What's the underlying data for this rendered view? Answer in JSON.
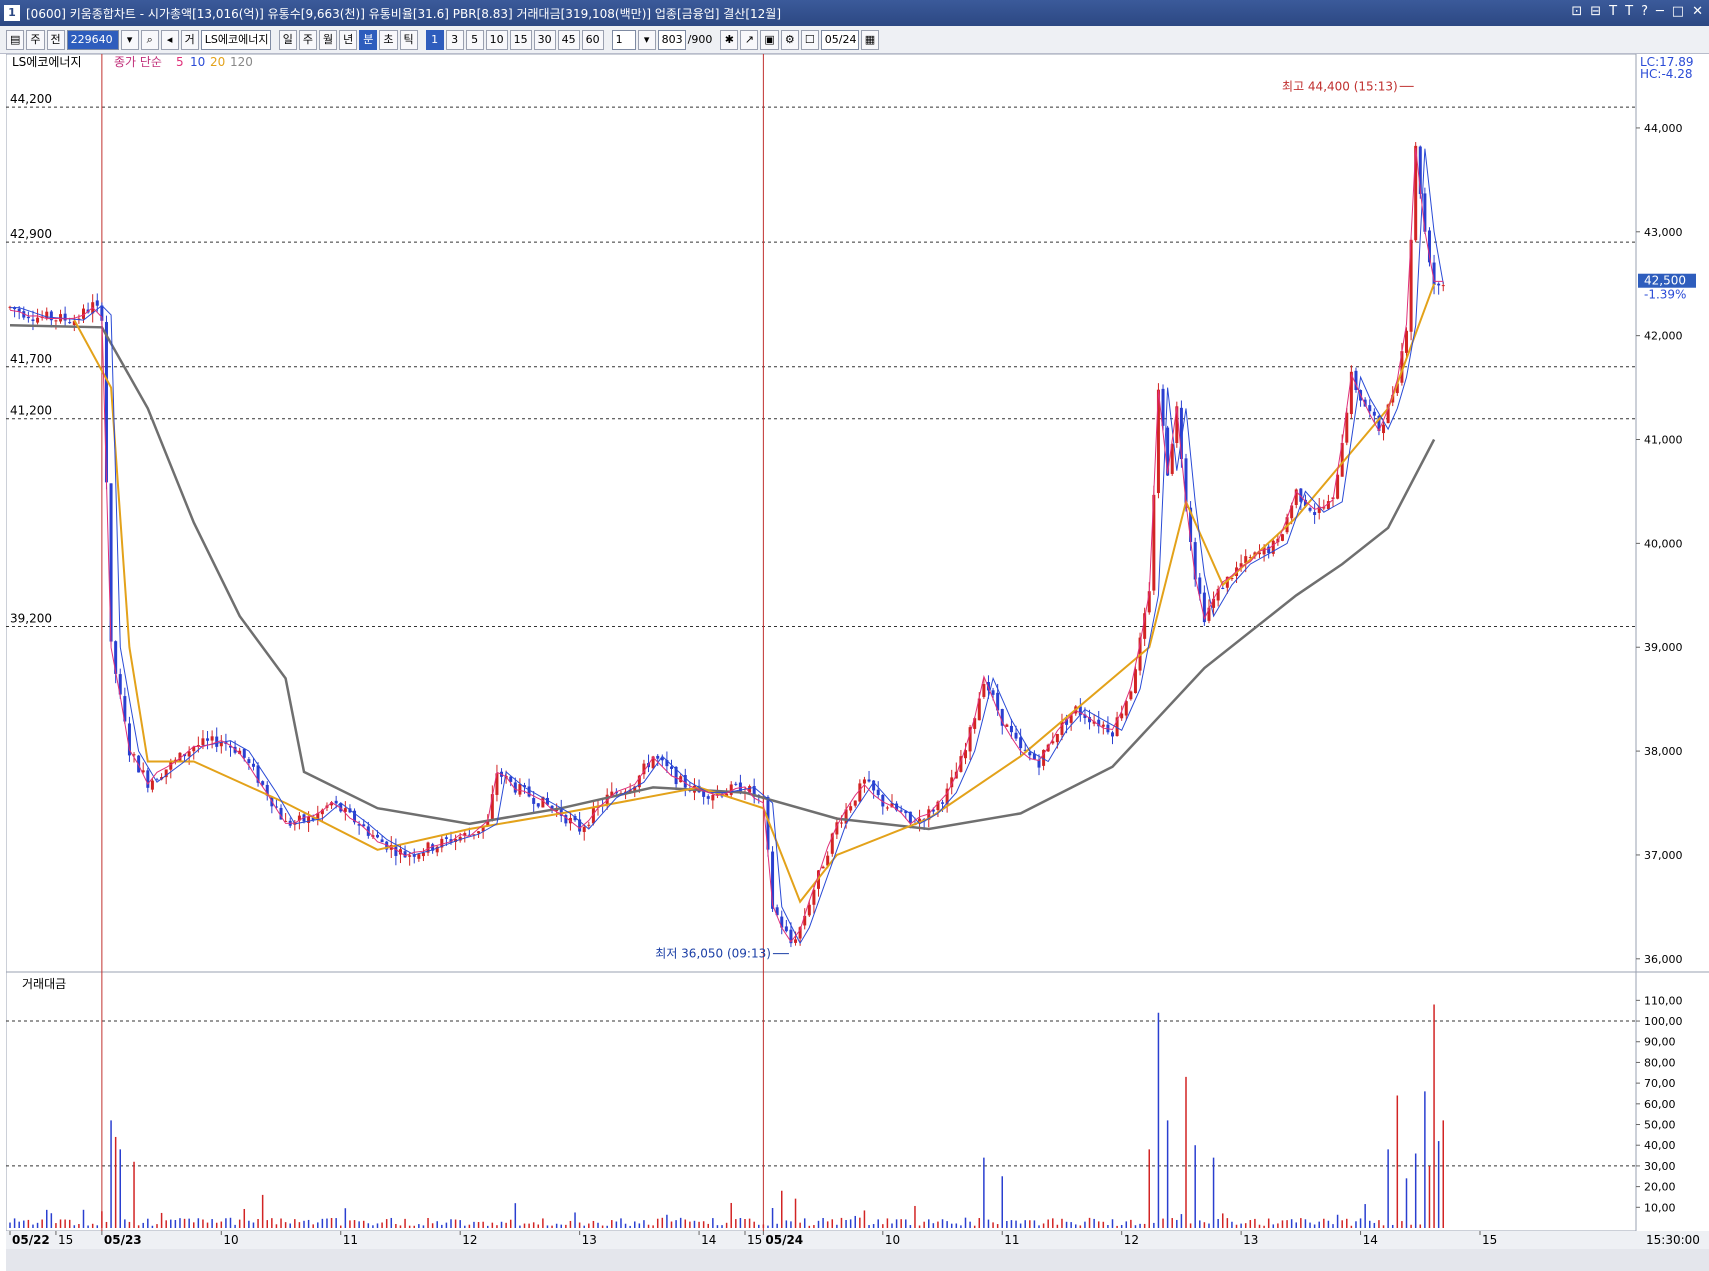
{
  "window": {
    "number": "1",
    "title": "[0600] 키움종합차트 - 시가총액[13,016(억)] 유통수[9,663(천)] 유통비율[31.6] PBR[8.83] 거래대금[319,108(백만)] 업종[금융업] 결산[12월]",
    "controls": [
      "⊡",
      "⊟",
      "T",
      "T",
      "?",
      "─",
      "□",
      "✕"
    ]
  },
  "toolbar": {
    "market": "주",
    "prev": "전",
    "code": "229640",
    "group": "거",
    "stock_name": "LS에코에너지",
    "periods": [
      "일",
      "주",
      "월",
      "년",
      "분",
      "초",
      "틱"
    ],
    "active_period": "분",
    "intervals": [
      "1",
      "3",
      "5",
      "10",
      "15",
      "30",
      "45",
      "60"
    ],
    "active_interval": "1",
    "count": "1",
    "display": "803",
    "display_max": "/900",
    "date": "05/24"
  },
  "legend": {
    "stock": "LS에코에너지",
    "price_label": "종가 단순",
    "ma": [
      {
        "period": "5",
        "color": "#e0307a"
      },
      {
        "period": "10",
        "color": "#2a4bd6"
      },
      {
        "period": "20",
        "color": "#e3a21a"
      },
      {
        "period": "120",
        "color": "#777777"
      }
    ],
    "lc": "LC:17.89",
    "hc": "HC:-4.28",
    "volume_title": "거래대금"
  },
  "annotations": {
    "high": "최고 44,400 (15:13)",
    "low": "최저 36,050 (09:13)",
    "current_price": "42,500",
    "current_change": "-1.39%"
  },
  "chart_data": {
    "type": "candlestick",
    "price_axis": {
      "ylim": [
        35950,
        44500
      ],
      "ticks": [
        "36,000",
        "37,000",
        "38,000",
        "39,000",
        "40,000",
        "41,000",
        "42,000",
        "43,000",
        "44,000"
      ]
    },
    "volume_axis": {
      "ylim": [
        0,
        115
      ],
      "ticks": [
        "10,00",
        "20,00",
        "30,00",
        "40,00",
        "50,00",
        "60,00",
        "70,00",
        "80,00",
        "90,00",
        "100,00",
        "110,00"
      ]
    },
    "h_lines": [
      {
        "value": 44200,
        "label": "44,200"
      },
      {
        "value": 42900,
        "label": "42,900"
      },
      {
        "value": 41700,
        "label": "41,700"
      },
      {
        "value": 41200,
        "label": "41,200"
      },
      {
        "value": 39200,
        "label": "39,200"
      }
    ],
    "volume_h_lines": [
      100,
      30
    ],
    "x_labels": [
      "05/22",
      "15",
      "05/23",
      "10",
      "11",
      "12",
      "13",
      "14",
      "15",
      "05/24",
      "10",
      "11",
      "12",
      "13",
      "14",
      "15"
    ],
    "x_end_label": "15:30:00",
    "day_breaks": [
      "05/23",
      "05/24"
    ],
    "price_path": [
      [
        0,
        42270
      ],
      [
        6,
        42180
      ],
      [
        14,
        42150
      ],
      [
        18,
        42290
      ],
      [
        20,
        42200
      ],
      [
        22,
        39000
      ],
      [
        26,
        38000
      ],
      [
        30,
        37700
      ],
      [
        36,
        37900
      ],
      [
        40,
        38050
      ],
      [
        46,
        38100
      ],
      [
        50,
        38000
      ],
      [
        56,
        37600
      ],
      [
        60,
        37300
      ],
      [
        66,
        37350
      ],
      [
        70,
        37500
      ],
      [
        76,
        37300
      ],
      [
        80,
        37150
      ],
      [
        86,
        37000
      ],
      [
        90,
        37050
      ],
      [
        96,
        37150
      ],
      [
        100,
        37200
      ],
      [
        104,
        37300
      ],
      [
        106,
        37800
      ],
      [
        110,
        37650
      ],
      [
        116,
        37500
      ],
      [
        120,
        37400
      ],
      [
        124,
        37250
      ],
      [
        130,
        37550
      ],
      [
        136,
        37700
      ],
      [
        140,
        37950
      ],
      [
        146,
        37700
      ],
      [
        150,
        37600
      ],
      [
        154,
        37600
      ],
      [
        160,
        37650
      ],
      [
        164,
        37500
      ],
      [
        166,
        36500
      ],
      [
        170,
        36150
      ],
      [
        172,
        36300
      ],
      [
        176,
        36800
      ],
      [
        180,
        37300
      ],
      [
        186,
        37700
      ],
      [
        190,
        37500
      ],
      [
        194,
        37400
      ],
      [
        196,
        37300
      ],
      [
        200,
        37400
      ],
      [
        204,
        37600
      ],
      [
        208,
        38000
      ],
      [
        212,
        38700
      ],
      [
        216,
        38300
      ],
      [
        220,
        38000
      ],
      [
        224,
        37900
      ],
      [
        228,
        38200
      ],
      [
        232,
        38400
      ],
      [
        236,
        38300
      ],
      [
        240,
        38200
      ],
      [
        244,
        38600
      ],
      [
        248,
        39500
      ],
      [
        250,
        41500
      ],
      [
        252,
        40700
      ],
      [
        254,
        41300
      ],
      [
        256,
        40400
      ],
      [
        258,
        39700
      ],
      [
        260,
        39300
      ],
      [
        264,
        39600
      ],
      [
        268,
        39800
      ],
      [
        272,
        39900
      ],
      [
        276,
        40000
      ],
      [
        280,
        40500
      ],
      [
        284,
        40300
      ],
      [
        288,
        40400
      ],
      [
        292,
        41600
      ],
      [
        294,
        41400
      ],
      [
        298,
        41100
      ],
      [
        300,
        41300
      ],
      [
        302,
        41600
      ],
      [
        304,
        42100
      ],
      [
        306,
        43800
      ],
      [
        308,
        43000
      ],
      [
        310,
        42500
      ]
    ],
    "high_point": {
      "x": 306,
      "value": 44400
    },
    "low_point": {
      "x": 170,
      "value": 36050
    },
    "ma20_path": [
      [
        14,
        42150
      ],
      [
        22,
        41500
      ],
      [
        26,
        39000
      ],
      [
        30,
        37900
      ],
      [
        40,
        37900
      ],
      [
        60,
        37500
      ],
      [
        80,
        37050
      ],
      [
        100,
        37250
      ],
      [
        120,
        37400
      ],
      [
        150,
        37650
      ],
      [
        164,
        37450
      ],
      [
        172,
        36550
      ],
      [
        180,
        37000
      ],
      [
        200,
        37350
      ],
      [
        220,
        37950
      ],
      [
        248,
        39000
      ],
      [
        256,
        40400
      ],
      [
        264,
        39600
      ],
      [
        280,
        40250
      ],
      [
        300,
        41300
      ],
      [
        310,
        42500
      ]
    ],
    "ma120_path": [
      [
        0,
        42100
      ],
      [
        20,
        42080
      ],
      [
        30,
        41300
      ],
      [
        40,
        40200
      ],
      [
        50,
        39300
      ],
      [
        60,
        38700
      ],
      [
        64,
        37800
      ],
      [
        80,
        37450
      ],
      [
        100,
        37300
      ],
      [
        120,
        37450
      ],
      [
        140,
        37650
      ],
      [
        160,
        37600
      ],
      [
        180,
        37350
      ],
      [
        200,
        37250
      ],
      [
        220,
        37400
      ],
      [
        240,
        37850
      ],
      [
        260,
        38800
      ],
      [
        280,
        39500
      ],
      [
        290,
        39800
      ],
      [
        300,
        40150
      ],
      [
        310,
        41000
      ]
    ],
    "volume_spikes": [
      {
        "x": 22,
        "value": 52
      },
      {
        "x": 23,
        "value": 44
      },
      {
        "x": 24,
        "value": 38
      },
      {
        "x": 27,
        "value": 32
      },
      {
        "x": 55,
        "value": 16
      },
      {
        "x": 110,
        "value": 12
      },
      {
        "x": 168,
        "value": 18
      },
      {
        "x": 212,
        "value": 34
      },
      {
        "x": 216,
        "value": 25
      },
      {
        "x": 248,
        "value": 38
      },
      {
        "x": 250,
        "value": 104
      },
      {
        "x": 252,
        "value": 52
      },
      {
        "x": 256,
        "value": 73
      },
      {
        "x": 258,
        "value": 40
      },
      {
        "x": 262,
        "value": 34
      },
      {
        "x": 300,
        "value": 38
      },
      {
        "x": 302,
        "value": 64
      },
      {
        "x": 304,
        "value": 24
      },
      {
        "x": 306,
        "value": 36
      },
      {
        "x": 308,
        "value": 66
      },
      {
        "x": 309,
        "value": 30
      },
      {
        "x": 310,
        "value": 108
      },
      {
        "x": 311,
        "value": 42
      },
      {
        "x": 312,
        "value": 52
      }
    ]
  }
}
